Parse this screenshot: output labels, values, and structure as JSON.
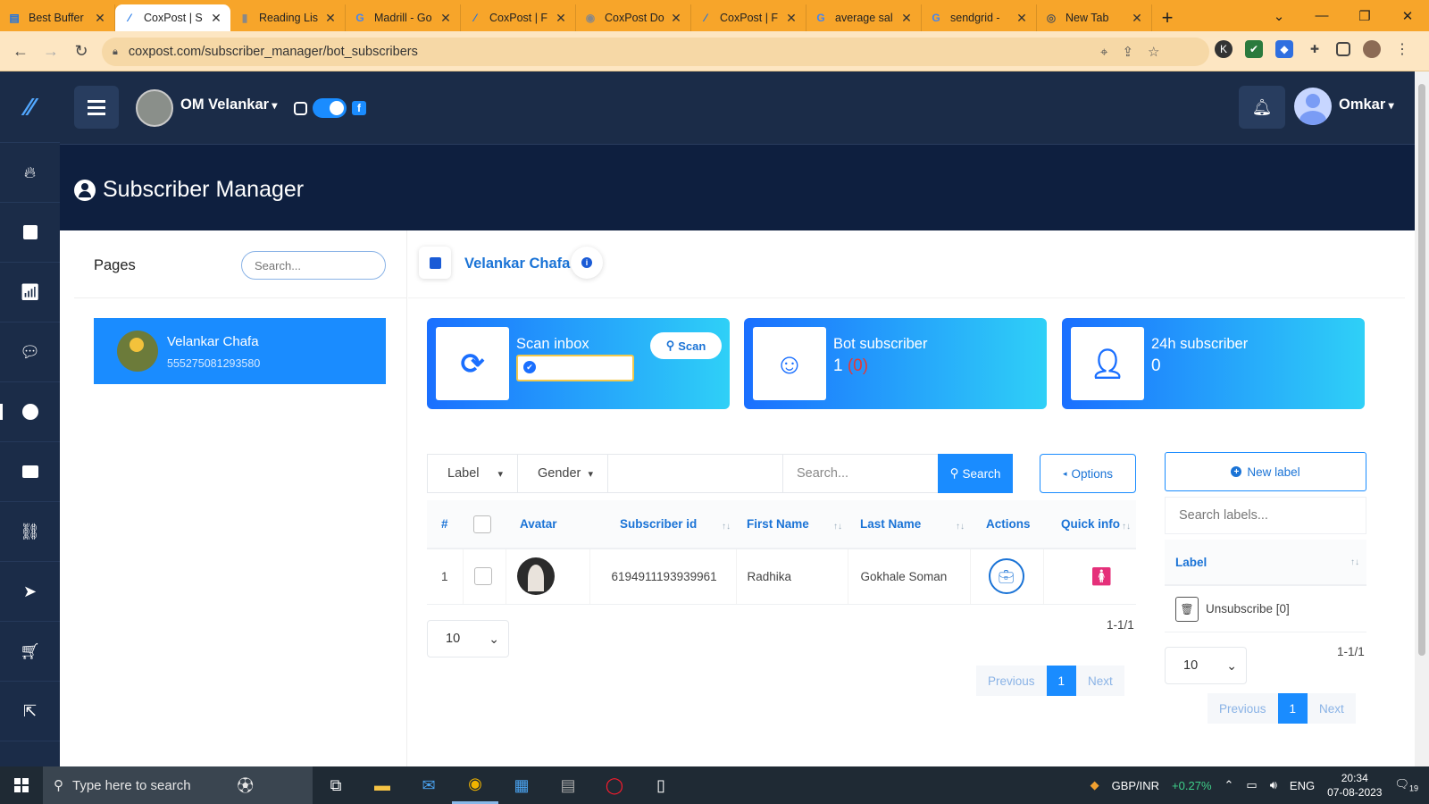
{
  "browser": {
    "tabs": [
      {
        "title": "Best Buffer",
        "icon": "buffer-icon",
        "active": false
      },
      {
        "title": "CoxPost | S",
        "icon": "coxpost-icon",
        "active": true
      },
      {
        "title": "Reading Lis",
        "icon": "reading-list-icon",
        "active": false
      },
      {
        "title": "Madrill - Go",
        "icon": "google-icon",
        "active": false
      },
      {
        "title": "CoxPost | F",
        "icon": "coxpost-icon",
        "active": false
      },
      {
        "title": "CoxPost Do",
        "icon": "globe-icon",
        "active": false
      },
      {
        "title": "CoxPost | F",
        "icon": "coxpost-icon",
        "active": false
      },
      {
        "title": "average sal",
        "icon": "google-icon",
        "active": false
      },
      {
        "title": "sendgrid - ",
        "icon": "google-icon",
        "active": false
      },
      {
        "title": "New Tab",
        "icon": "chrome-icon",
        "active": false
      }
    ],
    "url": "coxpost.com/subscriber_manager/bot_subscribers"
  },
  "topbar": {
    "page_account": "OM Velankar",
    "user_name": "Omkar"
  },
  "header": {
    "title": "Subscriber Manager"
  },
  "pages_panel": {
    "title": "Pages",
    "search_placeholder": "Search...",
    "page": {
      "name": "Velankar Chafa",
      "id": "555275081293580"
    }
  },
  "page_header": {
    "name": "Velankar Chafa"
  },
  "cards": {
    "scan": {
      "title": "Scan inbox",
      "button": "Scan"
    },
    "bot": {
      "title": "Bot subscriber",
      "value": "1",
      "sub_value": "(0)"
    },
    "day": {
      "title": "24h subscriber",
      "value": "0"
    }
  },
  "filters": {
    "label": "Label",
    "gender": "Gender",
    "search_placeholder": "Search...",
    "search_button": "Search",
    "options_button": "Options"
  },
  "table": {
    "headers": {
      "num": "#",
      "avatar": "Avatar",
      "subscriber_id": "Subscriber id",
      "first_name": "First Name",
      "last_name": "Last Name",
      "actions": "Actions",
      "quick_info": "Quick info"
    },
    "rows": [
      {
        "num": "1",
        "subscriber_id": "6194911193939961",
        "first_name": "Radhika",
        "last_name": "Gokhale Soman",
        "gender": "female"
      }
    ],
    "page_size": "10",
    "range": "1-1/1",
    "pager": {
      "prev": "Previous",
      "current": "1",
      "next": "Next"
    }
  },
  "labels": {
    "new_label": "New label",
    "search_placeholder": "Search labels...",
    "header": "Label",
    "rows": [
      {
        "name": "Unsubscribe [0]"
      }
    ],
    "page_size": "10",
    "range": "1-1/1",
    "pager": {
      "prev": "Previous",
      "current": "1",
      "next": "Next"
    }
  },
  "taskbar": {
    "search_placeholder": "Type here to search",
    "stock": "GBP/INR",
    "stock_change": "+0.27%",
    "lang": "ENG",
    "time": "20:34",
    "date": "07-08-2023",
    "notif_count": "19"
  },
  "colors": {
    "accent": "#1a8cff",
    "navy": "#1b2c48",
    "browser": "#f7a52a"
  }
}
